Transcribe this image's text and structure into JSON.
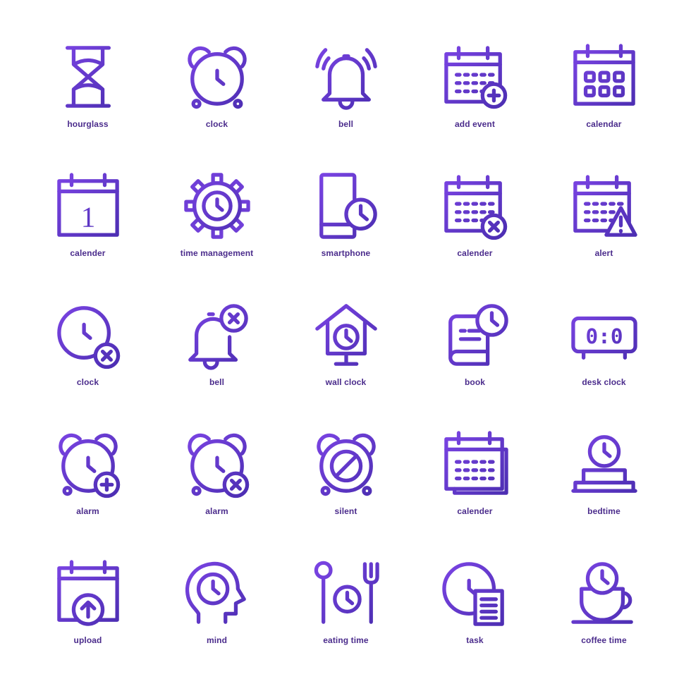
{
  "colors": {
    "gradient_start": "#7d45e6",
    "gradient_end": "#4a2db0",
    "label": "#4b2c8c",
    "background": "#ffffff"
  },
  "icons": [
    {
      "icon": "hourglass-icon",
      "label": "hourglass"
    },
    {
      "icon": "alarm-clock-icon",
      "label": "clock"
    },
    {
      "icon": "ringing-bell-icon",
      "label": "bell"
    },
    {
      "icon": "calendar-add-icon",
      "label": "add event"
    },
    {
      "icon": "calendar-grid-icon",
      "label": "calendar"
    },
    {
      "icon": "calendar-day-icon",
      "label": "calender",
      "glyph": "1"
    },
    {
      "icon": "gear-clock-icon",
      "label": "time management"
    },
    {
      "icon": "smartphone-clock-icon",
      "label": "smartphone"
    },
    {
      "icon": "calendar-remove-icon",
      "label": "calender"
    },
    {
      "icon": "calendar-alert-icon",
      "label": "alert"
    },
    {
      "icon": "clock-remove-icon",
      "label": "clock"
    },
    {
      "icon": "bell-remove-icon",
      "label": "bell"
    },
    {
      "icon": "wall-clock-icon",
      "label": "wall clock"
    },
    {
      "icon": "book-clock-icon",
      "label": "book"
    },
    {
      "icon": "desk-clock-icon",
      "label": "desk clock",
      "glyph": "0:0"
    },
    {
      "icon": "alarm-add-icon",
      "label": "alarm"
    },
    {
      "icon": "alarm-remove-icon",
      "label": "alarm"
    },
    {
      "icon": "alarm-silent-icon",
      "label": "silent"
    },
    {
      "icon": "calendar-stack-icon",
      "label": "calender"
    },
    {
      "icon": "bedtime-icon",
      "label": "bedtime"
    },
    {
      "icon": "calendar-upload-icon",
      "label": "upload"
    },
    {
      "icon": "mind-clock-icon",
      "label": "mind"
    },
    {
      "icon": "eating-time-icon",
      "label": "eating time"
    },
    {
      "icon": "task-clock-icon",
      "label": "task"
    },
    {
      "icon": "coffee-time-icon",
      "label": "coffee time"
    }
  ]
}
